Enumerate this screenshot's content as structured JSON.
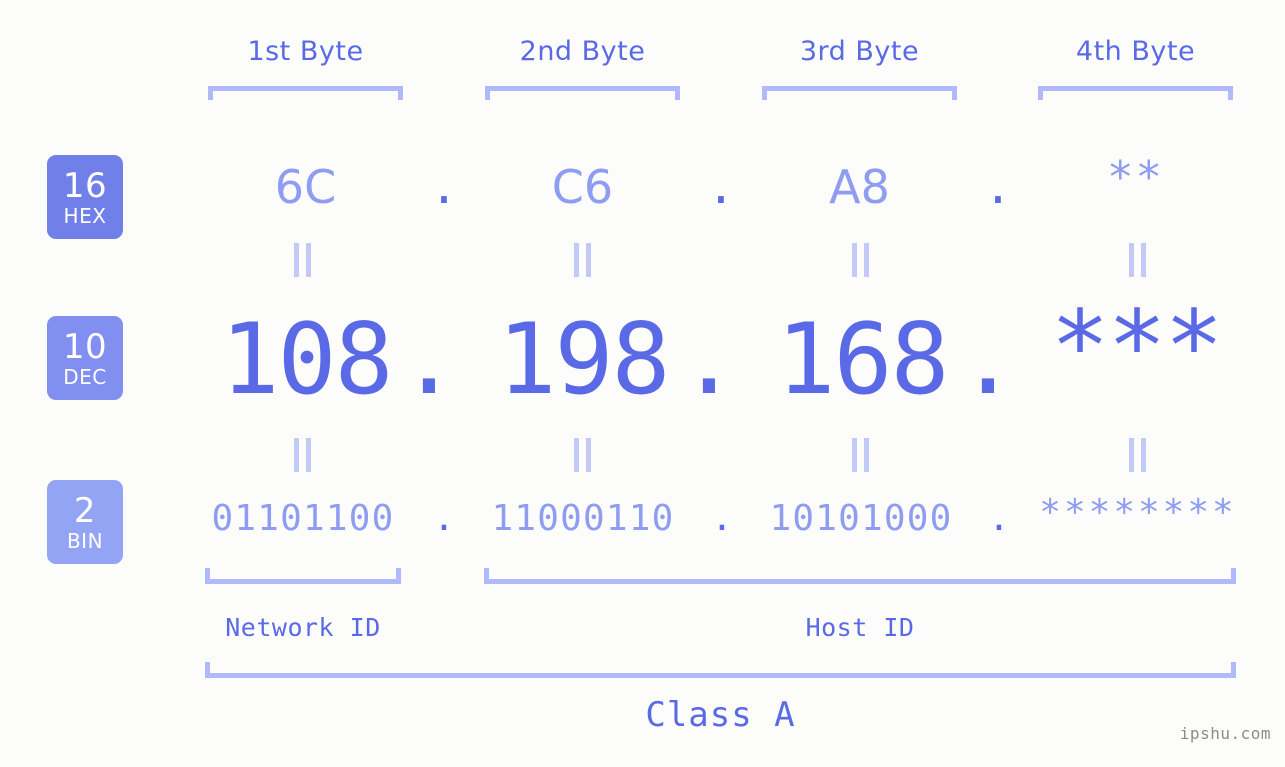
{
  "background_color": "#fcfdfa",
  "accent_color": "#5a6ae6",
  "accent_light": "#8e9cf2",
  "bracket_color": "#b0b9fb",
  "header": {
    "byte_labels": [
      {
        "label": "1st Byte"
      },
      {
        "label": "2nd Byte"
      },
      {
        "label": "3rd Byte"
      },
      {
        "label": "4th Byte"
      }
    ]
  },
  "bases": [
    {
      "number": "16",
      "abbr": "HEX",
      "color": "#7180e8"
    },
    {
      "number": "10",
      "abbr": "DEC",
      "color": "#808ff0"
    },
    {
      "number": "2",
      "abbr": "BIN",
      "color": "#93a4f5"
    }
  ],
  "rows": {
    "hex": {
      "base": "16",
      "name": "HEX",
      "values": [
        "6C",
        "C6",
        "A8",
        "**"
      ],
      "separators": [
        ".",
        ".",
        "."
      ]
    },
    "dec": {
      "base": "10",
      "name": "DEC",
      "values": [
        "108",
        "198",
        "168",
        "***"
      ],
      "separators": [
        ".",
        ".",
        "."
      ]
    },
    "bin": {
      "base": "2",
      "name": "BIN",
      "values": [
        "01101100",
        "11000110",
        "10101000",
        "********"
      ],
      "separators": [
        ".",
        ".",
        "."
      ]
    }
  },
  "equals_symbol": "=",
  "footer": {
    "network_id_label": "Network ID",
    "host_id_label": "Host ID",
    "class_label": "Class A"
  },
  "watermark": "ipshu.com"
}
